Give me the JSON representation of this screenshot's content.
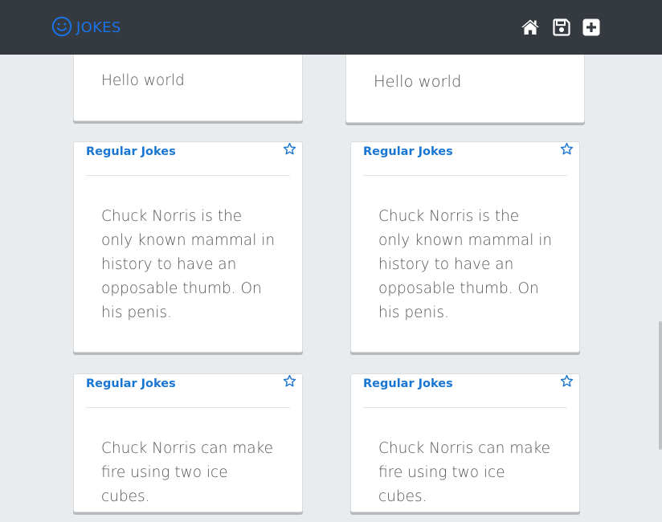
{
  "app": {
    "brand": "JOKES"
  },
  "nav": {
    "icons": [
      "smiley-icon",
      "home-icon",
      "save-icon",
      "plus-square-icon"
    ]
  },
  "colors": {
    "navbar": "#343a40",
    "accent": "#1a73e8",
    "title": "#1976d2",
    "background": "#e9ecef"
  },
  "cards": [
    {
      "text": "Hello world"
    },
    {
      "text": "Hello world"
    },
    {
      "category": "Regular Jokes",
      "text": "Chuck Norris is the only known mammal in history to have an opposable thumb. On his penis."
    },
    {
      "category": "Regular Jokes",
      "text": "Chuck Norris is the only known mammal in history to have an opposable thumb. On his penis."
    },
    {
      "category": "Regular Jokes",
      "text": "Chuck Norris can make fire using two ice cubes."
    },
    {
      "category": "Regular Jokes",
      "text": "Chuck Norris can make fire using two ice cubes."
    }
  ]
}
